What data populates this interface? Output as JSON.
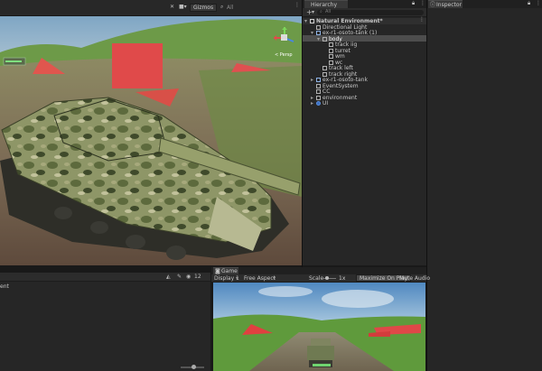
{
  "scene": {
    "toolbar_icons": [
      "scene-view-tool-icon",
      "camera-icon",
      "gizmos-icon",
      "search-icon"
    ],
    "gizmos_label": "Gizmos",
    "all_label": "All",
    "persp_label": "< Persp"
  },
  "hierarchy": {
    "tab_label": "Hierarchy",
    "add_label": "+",
    "search_label": "All",
    "items": [
      {
        "label": "Natural Environment*",
        "depth": 0,
        "arrow": "▾",
        "kind": "scene"
      },
      {
        "label": "Directional Light",
        "depth": 1,
        "arrow": "",
        "kind": "object"
      },
      {
        "label": "ex-r1-osoto-tank (1)",
        "depth": 1,
        "arrow": "▾",
        "kind": "prefab"
      },
      {
        "label": "body",
        "depth": 2,
        "arrow": "▾",
        "kind": "object",
        "selected": true
      },
      {
        "label": "track iig",
        "depth": 3,
        "arrow": "",
        "kind": "object"
      },
      {
        "label": "turret",
        "depth": 3,
        "arrow": "",
        "kind": "object"
      },
      {
        "label": "wm",
        "depth": 3,
        "arrow": "",
        "kind": "object"
      },
      {
        "label": "wc",
        "depth": 3,
        "arrow": "",
        "kind": "object"
      },
      {
        "label": "track left",
        "depth": 2,
        "arrow": "",
        "kind": "object"
      },
      {
        "label": "track right",
        "depth": 2,
        "arrow": "",
        "kind": "object"
      },
      {
        "label": "ex-r1-osoto-tank",
        "depth": 1,
        "arrow": "▸",
        "kind": "prefab"
      },
      {
        "label": "EventSystem",
        "depth": 1,
        "arrow": "",
        "kind": "object"
      },
      {
        "label": "CC",
        "depth": 1,
        "arrow": "",
        "kind": "object"
      },
      {
        "label": "environment",
        "depth": 1,
        "arrow": "▸",
        "kind": "object"
      },
      {
        "label": "UI",
        "depth": 1,
        "arrow": "▸",
        "kind": "ui"
      }
    ]
  },
  "inspector": {
    "tab_label": "Inspector"
  },
  "bottom_panel": {
    "label": "ent",
    "count_label": "12"
  },
  "game": {
    "tab_label": "Game",
    "display_label": "Display 1",
    "aspect_label": "Free Aspect",
    "scale_label": "Scale",
    "scale_value": "1x",
    "maximize_label": "Maximize On Play",
    "mute_label": "Mute Audio"
  }
}
